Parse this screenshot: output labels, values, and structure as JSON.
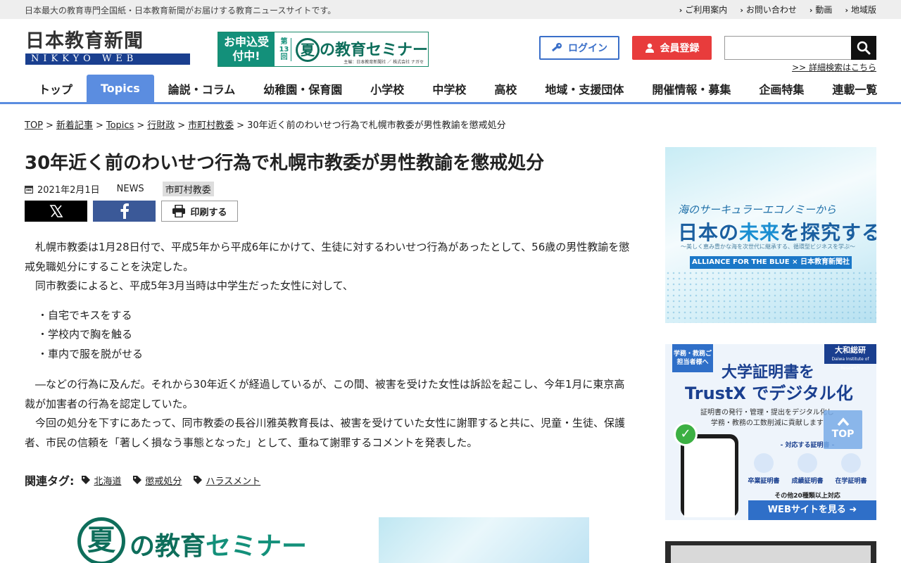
{
  "topbar": {
    "tagline": "日本最大の教育専門全国紙・日本教育新聞がお届けする教育ニュースサイトです。",
    "links": [
      "ご利用案内",
      "お問い合わせ",
      "動画",
      "地域版"
    ]
  },
  "header": {
    "logo_jp": "日本教育新聞",
    "logo_en": "NIKKYO WEB",
    "banner": {
      "apply": "お申込受付中!",
      "edition": "第13回",
      "title_natsu": "夏",
      "title_rest": "の教育",
      "title_kata": "セミナー",
      "sponsor": "主催：日本教育新聞社 ／ 株式会社 ナガセ"
    },
    "login_label": "ログイン",
    "register_label": "会員登録",
    "search_placeholder": "",
    "advanced_search": ">> 詳細検索はこちら"
  },
  "nav": {
    "items": [
      "トップ",
      "Topics",
      "論説・コラム",
      "幼稚園・保育園",
      "小学校",
      "中学校",
      "高校",
      "地域・支援団体",
      "開催情報・募集",
      "企画特集",
      "連載一覧"
    ],
    "active": "Topics"
  },
  "breadcrumb": {
    "links": [
      "TOP",
      "新着記事",
      "Topics",
      "行財政",
      "市町村教委"
    ],
    "current": "30年近く前のわいせつ行為で札幌市教委が男性教諭を懲戒処分",
    "separator": ">"
  },
  "article": {
    "title": "30年近く前のわいせつ行為で札幌市教委が男性教諭を懲戒処分",
    "date": "2021年2月1日",
    "category": "NEWS",
    "tag": "市町村教委",
    "print_label": "印刷する",
    "para1": "札幌市教委は1月28日付で、平成5年から平成6年にかけて、生徒に対するわいせつ行為があったとして、56歳の男性教諭を懲戒免職処分にすることを決定した。",
    "para2": "同市教委によると、平成5年3月当時は中学生だった女性に対して、",
    "list": [
      "・自宅でキスをする",
      "・学校内で胸を触る",
      "・車内で服を脱がせる"
    ],
    "para3": "―などの行為に及んだ。それから30年近くが経過しているが、この間、被害を受けた女性は訴訟を起こし、今年1月に東京高裁が加害者の行為を認定していた。",
    "para4": "今回の処分を下すにあたって、同市教委の長谷川雅英教育長は、被害を受けていた女性に謝罪すると共に、児童・生徒、保護者、市民の信頼を「著しく損なう事態となった」として、重ねて謝罪するコメントを発表した。",
    "related_label": "関連タグ:",
    "related_tags": [
      "北海道",
      "懲戒処分",
      "ハラスメント"
    ]
  },
  "ads": {
    "seminar_natsu": "夏",
    "seminar_text": "の教育",
    "seminar_kata": "セミナー",
    "side1": {
      "line1": "海のサーキュラーエコノミーから",
      "line2a": "日本の",
      "line2b": "未来",
      "line2c": "を探究する",
      "line3": "〜美しく恵み豊かな海を次世代に継承する、循環型ビジネスを学ぶ〜",
      "bar": "ALLIANCE FOR THE BLUE × 日本教育新聞社"
    },
    "side2": {
      "corner": "学務・教務ご担当者様へ",
      "brand": "大和総研",
      "brand_sub": "Daiwa Institute of Research",
      "headline1": "大学証明書を",
      "headline2": "TrustX でデジタル化",
      "desc1": "証明書の発行・管理・提出をデジタル化し",
      "desc2": "学務・教務の工数削減に貢献します",
      "certs_header": "- 対応する証明書 -",
      "certs": [
        "卒業証明書",
        "成績証明書",
        "在学証明書"
      ],
      "more": "その他20種類以上対応",
      "cta": "WEBサイトを見る ➜"
    }
  },
  "to_top_label": "TOP",
  "colors": {
    "accent_blue": "#5b8de0",
    "register_red": "#e83c3c",
    "seminar_green": "#13907a",
    "facebook": "#3b5998"
  }
}
